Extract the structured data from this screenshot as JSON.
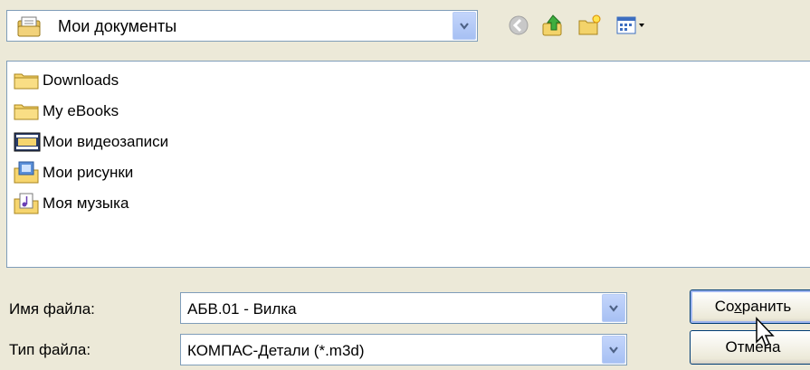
{
  "location": {
    "value": "Мои документы",
    "icon": "my-documents-icon"
  },
  "toolbar": {
    "back_icon": "back-icon",
    "up_icon": "up-folder-icon",
    "new_folder_icon": "new-folder-icon",
    "view_icon": "view-menu-icon"
  },
  "files": [
    {
      "name": "Downloads",
      "icon": "folder-icon"
    },
    {
      "name": "My eBooks",
      "icon": "folder-icon"
    },
    {
      "name": "Мои видеозаписи",
      "icon": "video-folder-icon"
    },
    {
      "name": "Мои рисунки",
      "icon": "pictures-folder-icon"
    },
    {
      "name": "Моя музыка",
      "icon": "music-folder-icon"
    }
  ],
  "filename": {
    "label": "Имя файла:",
    "value": "АБВ.01 - Вилка"
  },
  "filetype": {
    "label": "Тип файла:",
    "value": "КОМПАС-Детали (*.m3d)"
  },
  "buttons": {
    "save_pre": "Со",
    "save_u": "х",
    "save_post": "ранить",
    "cancel": "Отмена"
  },
  "colors": {
    "background": "#ece9d8",
    "field_border": "#7f9db9",
    "button_border": "#003c74"
  }
}
